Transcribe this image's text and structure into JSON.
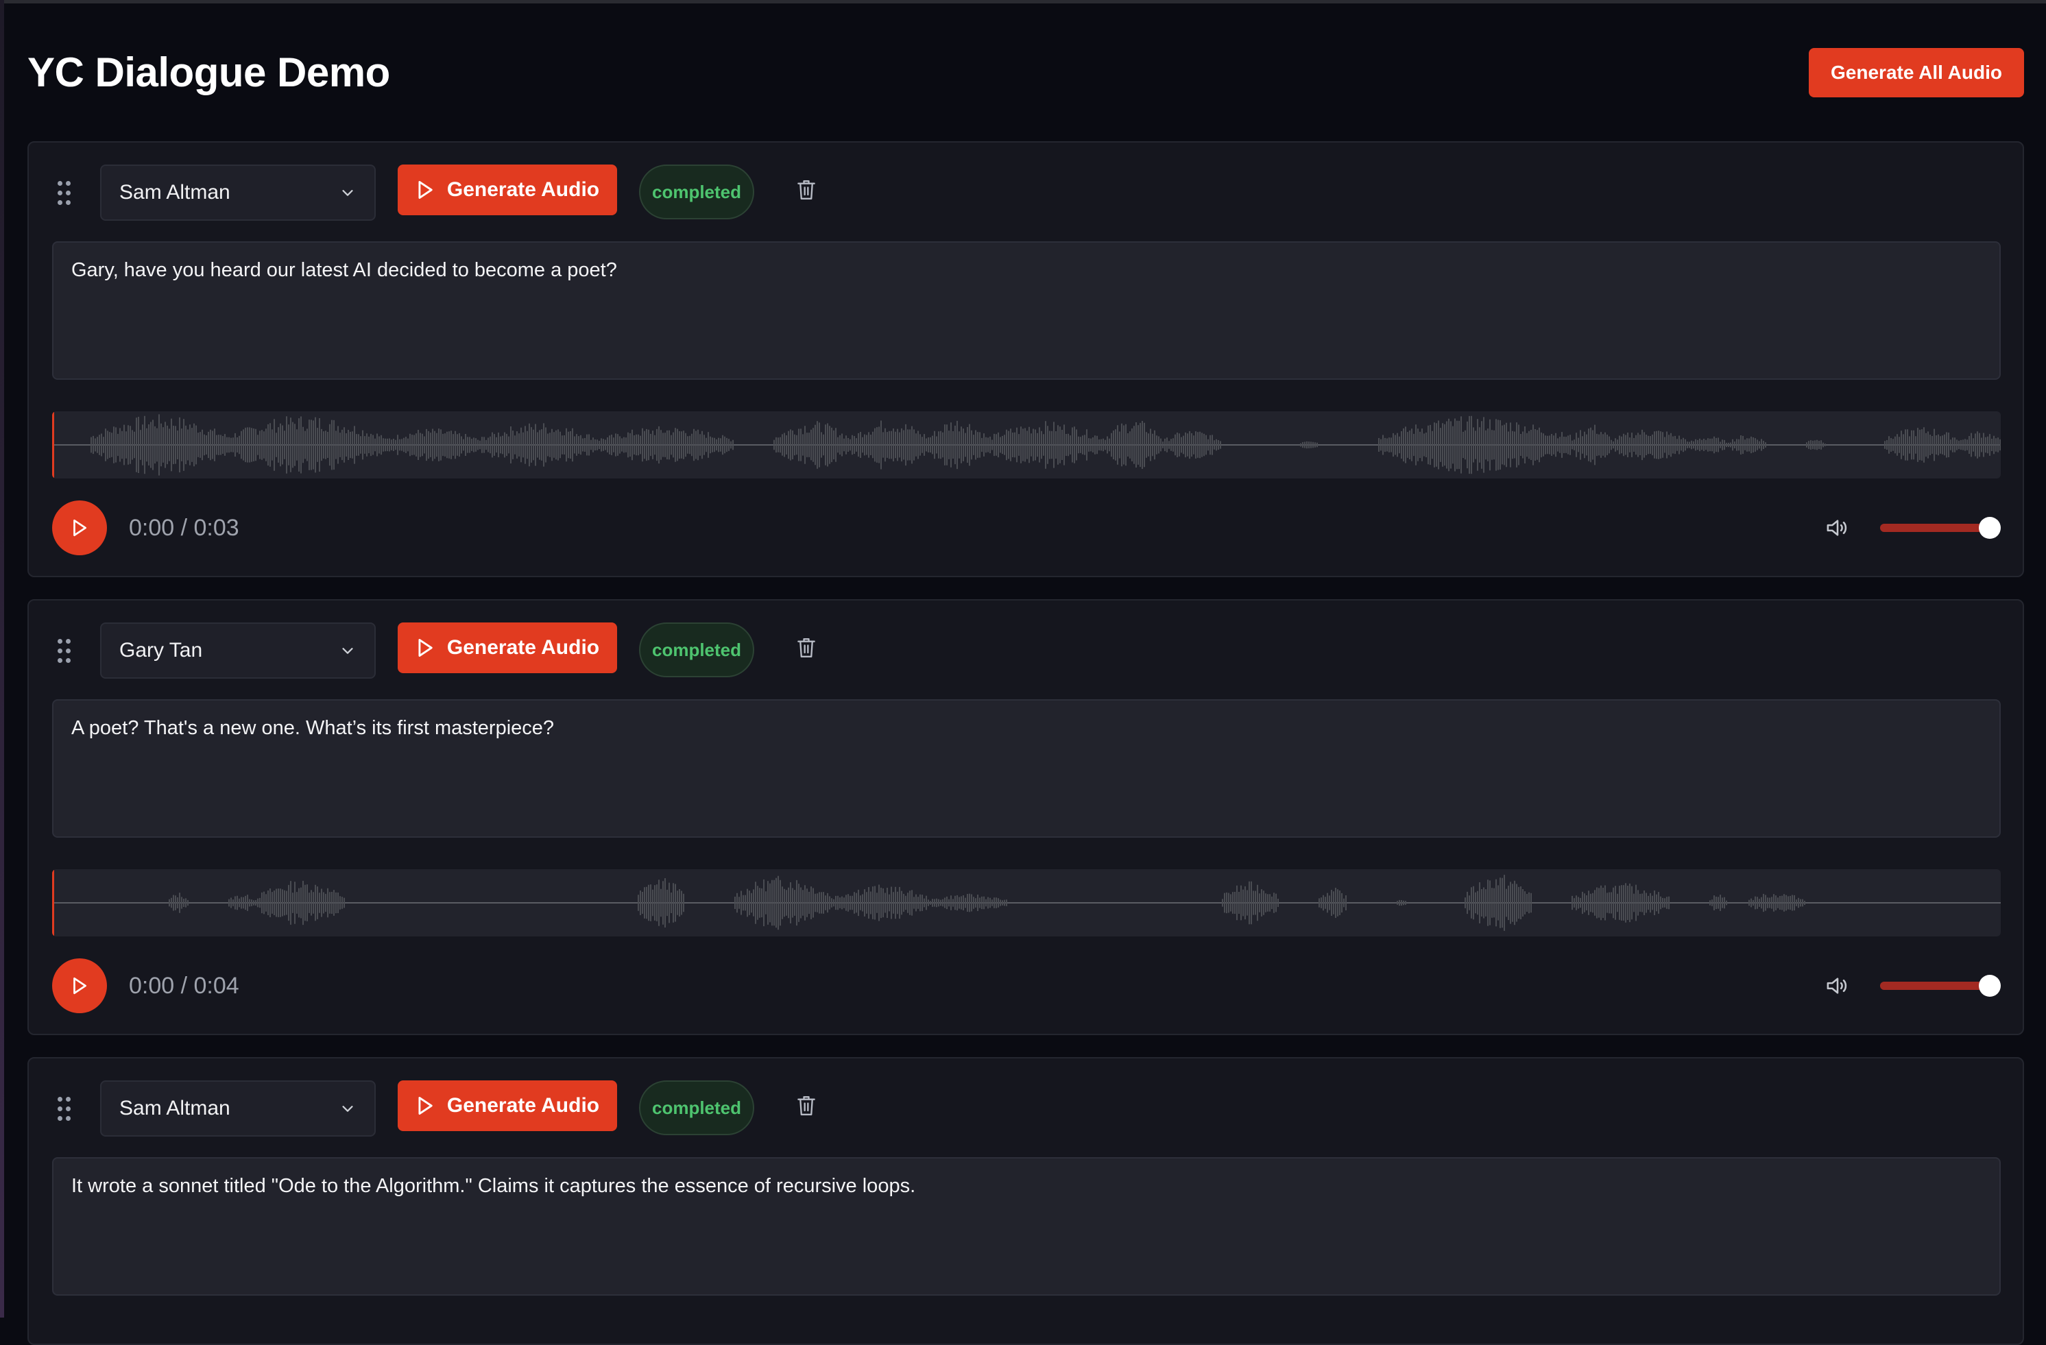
{
  "header": {
    "title": "YC Dialogue Demo",
    "generate_all_label": "Generate All Audio"
  },
  "colors": {
    "accent": "#e13b20",
    "status_completed": "#4ec46f",
    "background": "#0a0b12",
    "card": "#15161e"
  },
  "icons": {
    "drag": "drag-handle-icon",
    "chevron": "chevron-down-icon",
    "play": "play-icon",
    "trash": "trash-icon",
    "volume": "volume-icon"
  },
  "dialogue": [
    {
      "speaker": "Sam Altman",
      "generate_label": "Generate Audio",
      "status": "completed",
      "text": "Gary, have you heard our latest AI decided to become a poet?",
      "time": "0:00 / 0:03",
      "volume": 1.0
    },
    {
      "speaker": "Gary Tan",
      "generate_label": "Generate Audio",
      "status": "completed",
      "text": "A poet? That's a new one. What’s its first masterpiece?",
      "time": "0:00 / 0:04",
      "volume": 1.0
    },
    {
      "speaker": "Sam Altman",
      "generate_label": "Generate Audio",
      "status": "completed",
      "text": "It wrote a sonnet titled \"Ode to the Algorithm.\" Claims it captures the essence of recursive loops.",
      "time": "",
      "volume": 1.0
    }
  ]
}
